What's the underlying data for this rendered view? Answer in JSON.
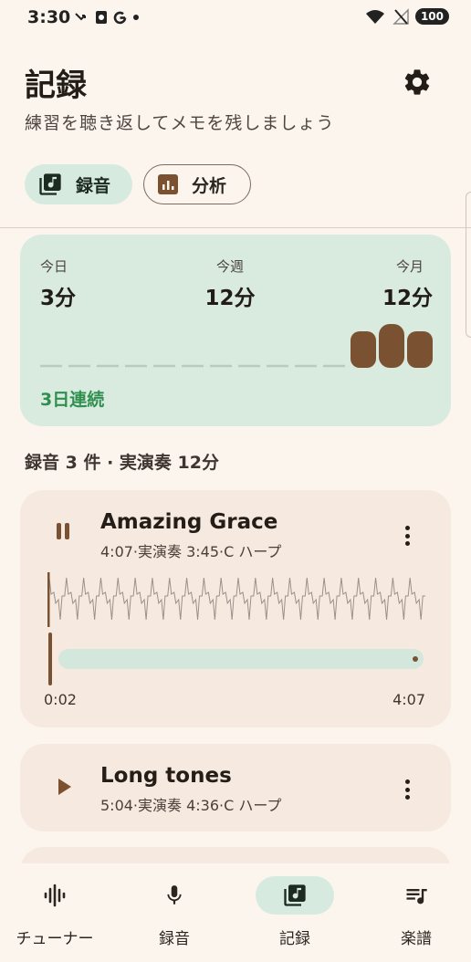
{
  "status_bar": {
    "time": "3:30",
    "battery": "100"
  },
  "header": {
    "title": "記録",
    "subtitle": "練習を聴き返してメモを残しましょう"
  },
  "tabs": [
    {
      "label": "録音",
      "active": true
    },
    {
      "label": "分析",
      "active": false
    }
  ],
  "stats": {
    "today_label": "今日",
    "today_value": "3分",
    "week_label": "今週",
    "week_value": "12分",
    "month_label": "今月",
    "month_value": "12分",
    "streak": "3日連続"
  },
  "summary": "録音 3 件 · 実演奏 12分",
  "recordings": [
    {
      "title": "Amazing Grace",
      "meta": "4:07·実演奏 3:45·C ハープ",
      "state": "playing",
      "position": "0:02",
      "duration": "4:07",
      "progress": 0.008
    },
    {
      "title": "Long tones",
      "meta": "5:04·実演奏 4:36·C ハープ",
      "state": "paused"
    }
  ],
  "nav": [
    {
      "label": "チューナー",
      "icon": "waveform-icon",
      "active": false
    },
    {
      "label": "録音",
      "icon": "mic-icon",
      "active": false
    },
    {
      "label": "記録",
      "icon": "music-library-icon",
      "active": true
    },
    {
      "label": "楽譜",
      "icon": "sheet-music-icon",
      "active": false
    }
  ],
  "colors": {
    "background": "#fbf5ee",
    "accent_green": "#2e8f4e",
    "card_green": "#d9eadf",
    "card_beige": "#f6e9df",
    "brown": "#7a5232"
  }
}
